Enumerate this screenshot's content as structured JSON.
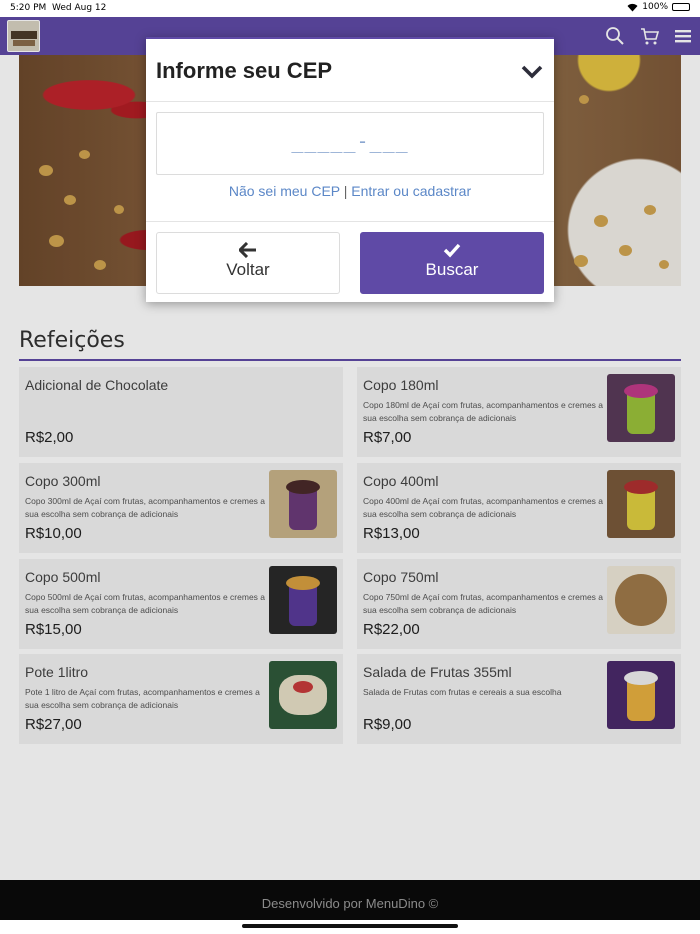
{
  "status_bar": {
    "time": "5:20 PM",
    "date": "Wed Aug 12",
    "battery": "100%"
  },
  "nav": {
    "icons": [
      "search-icon",
      "cart-icon",
      "menu-icon"
    ]
  },
  "colors": {
    "brand": "#5f4aa6",
    "link": "#5b87c7",
    "footer_bg": "#0b0b0b"
  },
  "section": {
    "title": "Refeições"
  },
  "products": [
    {
      "name": "Adicional de Chocolate",
      "desc": "",
      "price": "R$2,00",
      "image": false
    },
    {
      "name": "Copo 180ml",
      "desc": "Copo 180ml de Açaí com frutas, acompanhamentos e cremes a sua escolha sem cobrança de adicionais",
      "price": "R$7,00",
      "image": true
    },
    {
      "name": "Copo 300ml",
      "desc": "Copo 300ml de Açaí com frutas, acompanhamentos e cremes a sua escolha sem cobrança de adicionais",
      "price": "R$10,00",
      "image": true
    },
    {
      "name": "Copo 400ml",
      "desc": "Copo 400ml de Açaí com frutas, acompanhamentos e cremes a sua escolha sem cobrança de adicionais",
      "price": "R$13,00",
      "image": true
    },
    {
      "name": "Copo 500ml",
      "desc": "Copo 500ml de Açaí com frutas, acompanhamentos e cremes a sua escolha sem cobrança de adicionais",
      "price": "R$15,00",
      "image": true
    },
    {
      "name": "Copo 750ml",
      "desc": "Copo 750ml de Açaí com frutas, acompanhamentos e cremes a sua escolha sem cobrança de adicionais",
      "price": "R$22,00",
      "image": true
    },
    {
      "name": "Pote 1litro",
      "desc": "Pote 1 litro de Açaí com frutas, acompanhamentos e cremes a sua escolha sem cobrança de adicionais",
      "price": "R$27,00",
      "image": true
    },
    {
      "name": "Salada de Frutas 355ml",
      "desc": "Salada de Frutas com frutas e cereais a sua escolha",
      "price": "R$9,00",
      "image": true
    }
  ],
  "footer": {
    "text": "Desenvolvido por MenuDino ©"
  },
  "modal": {
    "title": "Informe seu CEP",
    "cep_placeholder": "_____-___",
    "link_unknown": "Não sei meu CEP",
    "link_separator": "|",
    "link_login": "Entrar ou cadastrar",
    "back_label": "Voltar",
    "search_label": "Buscar"
  }
}
